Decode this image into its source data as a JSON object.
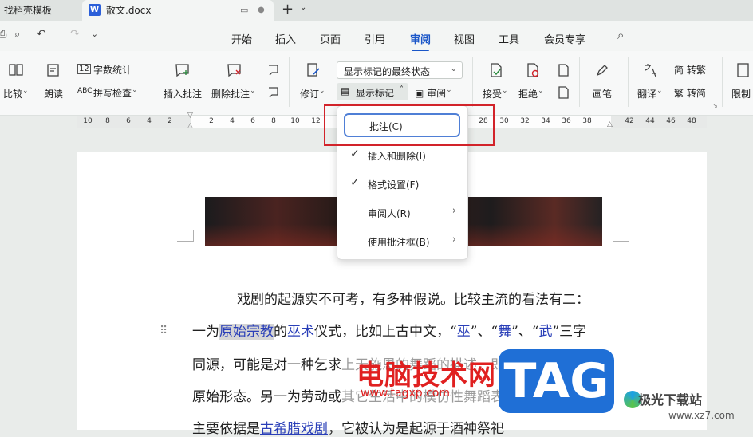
{
  "tabs": [
    {
      "label": "找稻壳模板"
    },
    {
      "label": "散文.docx"
    }
  ],
  "menu": [
    "开始",
    "插入",
    "页面",
    "引用",
    "审阅",
    "视图",
    "工具",
    "会员专享"
  ],
  "active_menu": "审阅",
  "ribbon": {
    "compare": "比较",
    "read_aloud": "朗读",
    "word_count": "字数统计",
    "spell_check": "拼写检查",
    "insert_comment": "插入批注",
    "delete_comment": "删除批注",
    "revise": "修订",
    "status_select": "显示标记的最终状态",
    "show_markup": "显示标记",
    "review": "审阅",
    "accept": "接受",
    "reject": "拒绝",
    "pen": "画笔",
    "translate": "翻译",
    "to_traditional": "简 转繁",
    "to_simplified": "繁 转简",
    "restrict": "限制"
  },
  "ruler_ticks": [
    "10",
    "8",
    "6",
    "4",
    "2",
    "2",
    "4",
    "6",
    "8",
    "10",
    "12",
    "28",
    "30",
    "32",
    "34",
    "36",
    "38",
    "42",
    "44",
    "46",
    "48"
  ],
  "dropdown": [
    {
      "label": "批注(C)",
      "checked": false,
      "submenu": false
    },
    {
      "label": "插入和删除(I)",
      "checked": true,
      "submenu": false
    },
    {
      "label": "格式设置(F)",
      "checked": true,
      "submenu": false
    },
    {
      "label": "审阅人(R)",
      "checked": false,
      "submenu": true
    },
    {
      "label": "使用批注框(B)",
      "checked": false,
      "submenu": true
    }
  ],
  "document": {
    "line1": "戏剧的起源实不可考，有多种假说。比较主流的看法有二：",
    "line2_a": "一为",
    "line2_hl": "原始宗教",
    "line2_b": "的",
    "line2_link1": "巫术",
    "line2_c": "仪式，比如上古中文，“",
    "line2_link2": "巫",
    "line2_d": "”、“",
    "line2_link3": "舞",
    "line2_e": "”、“",
    "line2_link4": "武",
    "line2_f": "”三字",
    "line3": "同源，可能是对一种乞求",
    "line3_ghost": "上天施恩的舞蹈的描述，即戏剧的",
    "line4": "原始形态。另一为劳动或",
    "line4_ghost": "其它生活中的模仿性舞蹈表演，这种说法",
    "line5": "主要依据是",
    "line5_link": "古希腊戏剧",
    "line5_b": "，它被认为是起源于酒神祭祀"
  },
  "watermark": {
    "text": "电脑技术网",
    "url": "www.tagxp.com",
    "tag": "TAG",
    "site": "极光下载站",
    "site_url": "www.xz7.com"
  }
}
